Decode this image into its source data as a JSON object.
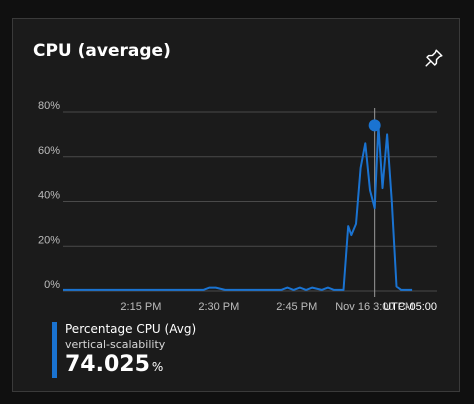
{
  "card": {
    "title": "CPU (average)",
    "pin_icon": "pin-icon"
  },
  "legend": {
    "series_name": "Percentage CPU (Avg)",
    "resource": "vertical-scalability",
    "value": "74.025",
    "unit": "%",
    "color": "#1a73d1"
  },
  "timezone": "UTC-05:00",
  "chart_data": {
    "type": "line",
    "title": "CPU (average)",
    "xlabel": "",
    "ylabel": "",
    "ylim": [
      0,
      80
    ],
    "yticks": [
      0,
      20,
      40,
      60,
      80
    ],
    "ytick_labels": [
      "0%",
      "20%",
      "40%",
      "60%",
      "80%"
    ],
    "xlim": [
      2.0,
      3.2
    ],
    "xticks": [
      2.25,
      2.5,
      2.75,
      3.0
    ],
    "xtick_labels": [
      "2:15 PM",
      "2:30 PM",
      "2:45 PM",
      "Nov 16 3:00 PM"
    ],
    "grid": true,
    "legend_position": "bottom-left",
    "highlight": {
      "x": 3.0,
      "y": 74.025
    },
    "series": [
      {
        "name": "Percentage CPU (Avg)",
        "color": "#1a73d1",
        "x": [
          2.0,
          2.1,
          2.2,
          2.3,
          2.45,
          2.47,
          2.49,
          2.52,
          2.6,
          2.7,
          2.72,
          2.74,
          2.76,
          2.78,
          2.8,
          2.83,
          2.85,
          2.87,
          2.89,
          2.9,
          2.915,
          2.925,
          2.94,
          2.955,
          2.97,
          2.985,
          3.0,
          3.012,
          3.025,
          3.04,
          3.055,
          3.07,
          3.085,
          3.1,
          3.12
        ],
        "y": [
          0.5,
          0.5,
          0.5,
          0.5,
          0.5,
          1.5,
          1.5,
          0.5,
          0.5,
          0.5,
          1.5,
          0.5,
          1.5,
          0.5,
          1.5,
          0.5,
          1.5,
          0.5,
          0.5,
          0.5,
          29,
          25,
          30,
          55,
          66,
          45,
          37,
          74,
          46,
          70,
          40,
          2,
          0.5,
          0.5,
          0.5
        ]
      }
    ]
  }
}
